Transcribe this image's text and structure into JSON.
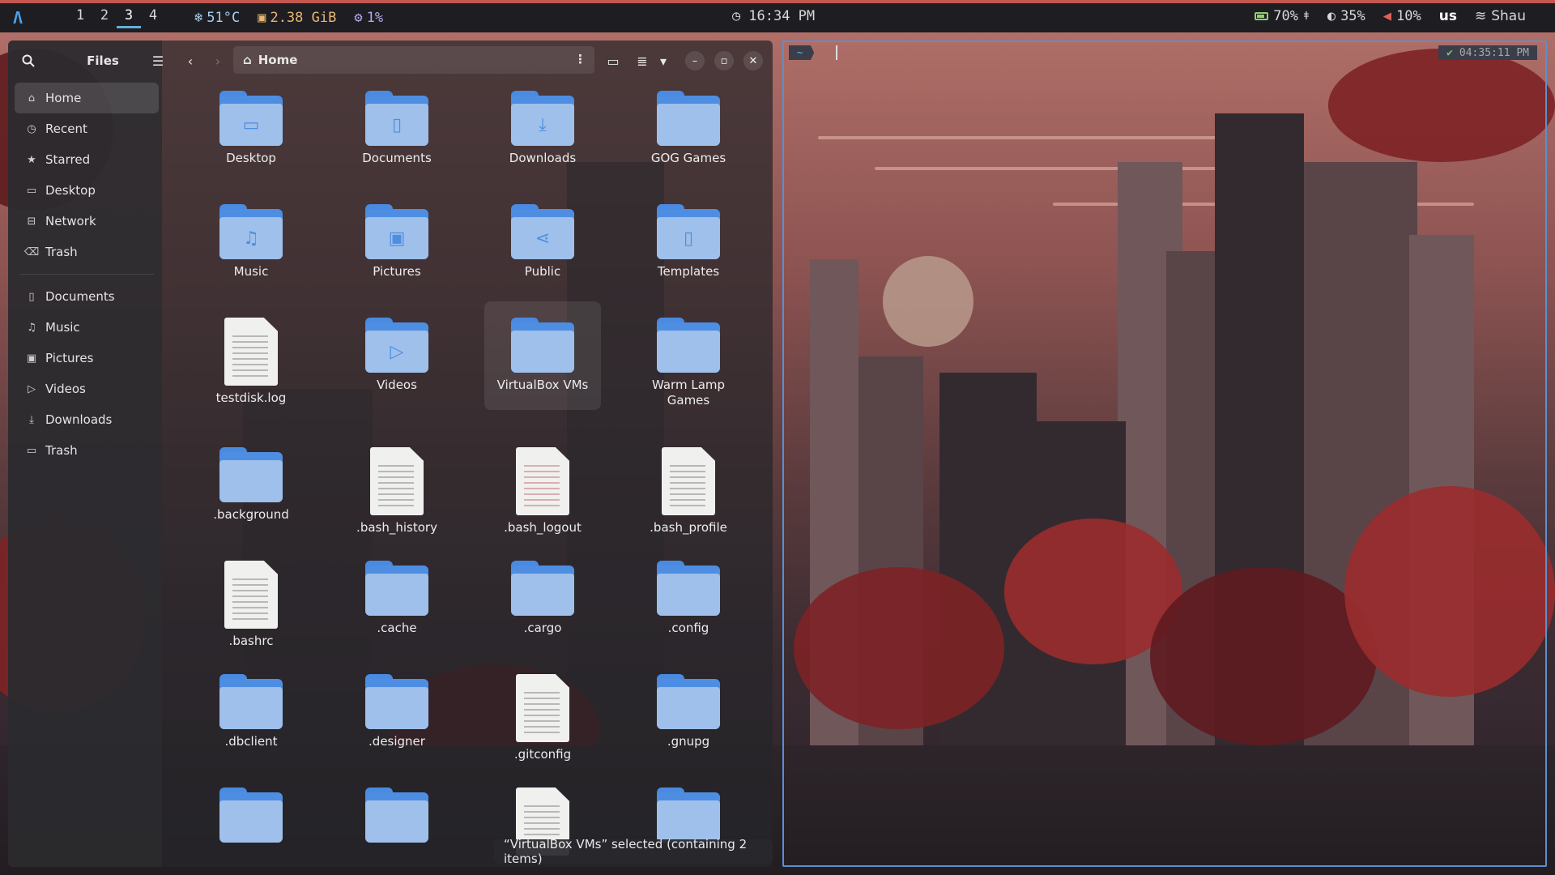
{
  "topbar": {
    "workspaces": [
      "1",
      "2",
      "3",
      "4"
    ],
    "active_workspace": "3",
    "temperature": "51°C",
    "memory": "2.38 GiB",
    "cpu": "1%",
    "clock": "16:34 PM",
    "battery": "70%",
    "brightness": "35%",
    "volume": "10%",
    "keyboard_layout": "us",
    "user": "Shau"
  },
  "files": {
    "title": "Files",
    "path": "Home",
    "sidebar": {
      "places": [
        {
          "label": "Home",
          "icon": "home-icon",
          "active": true
        },
        {
          "label": "Recent",
          "icon": "clock-icon"
        },
        {
          "label": "Starred",
          "icon": "star-icon"
        },
        {
          "label": "Desktop",
          "icon": "folder-icon"
        },
        {
          "label": "Network",
          "icon": "network-icon"
        },
        {
          "label": "Trash",
          "icon": "trash-icon"
        }
      ],
      "bookmarks": [
        {
          "label": "Documents",
          "icon": "document-icon"
        },
        {
          "label": "Music",
          "icon": "music-icon"
        },
        {
          "label": "Pictures",
          "icon": "image-icon"
        },
        {
          "label": "Videos",
          "icon": "video-icon"
        },
        {
          "label": "Downloads",
          "icon": "download-icon"
        },
        {
          "label": "Trash",
          "icon": "trash-icon"
        }
      ]
    },
    "items": [
      {
        "name": "Desktop",
        "kind": "folder",
        "emblem": "folder-icon"
      },
      {
        "name": "Documents",
        "kind": "folder",
        "emblem": "document-icon"
      },
      {
        "name": "Downloads",
        "kind": "folder",
        "emblem": "download-icon"
      },
      {
        "name": "GOG Games",
        "kind": "folder",
        "emblem": ""
      },
      {
        "name": "Music",
        "kind": "folder",
        "emblem": "music-icon"
      },
      {
        "name": "Pictures",
        "kind": "folder",
        "emblem": "image-icon"
      },
      {
        "name": "Public",
        "kind": "folder",
        "emblem": "share-icon"
      },
      {
        "name": "Templates",
        "kind": "folder",
        "emblem": "document-icon"
      },
      {
        "name": "testdisk.log",
        "kind": "file"
      },
      {
        "name": "Videos",
        "kind": "folder",
        "emblem": "video-icon"
      },
      {
        "name": "VirtualBox VMs",
        "kind": "folder",
        "emblem": "",
        "selected": true
      },
      {
        "name": "Warm Lamp Games",
        "kind": "folder",
        "emblem": ""
      },
      {
        "name": ".background",
        "kind": "folder",
        "emblem": ""
      },
      {
        "name": ".bash_history",
        "kind": "file"
      },
      {
        "name": ".bash_logout",
        "kind": "file",
        "warm": true
      },
      {
        "name": ".bash_profile",
        "kind": "file"
      },
      {
        "name": ".bashrc",
        "kind": "file"
      },
      {
        "name": ".cache",
        "kind": "folder",
        "emblem": ""
      },
      {
        "name": ".cargo",
        "kind": "folder",
        "emblem": ""
      },
      {
        "name": ".config",
        "kind": "folder",
        "emblem": ""
      },
      {
        "name": ".dbclient",
        "kind": "folder",
        "emblem": ""
      },
      {
        "name": ".designer",
        "kind": "folder",
        "emblem": ""
      },
      {
        "name": ".gitconfig",
        "kind": "file"
      },
      {
        "name": ".gnupg",
        "kind": "folder",
        "emblem": ""
      },
      {
        "name": "",
        "kind": "folder",
        "emblem": ""
      },
      {
        "name": "",
        "kind": "folder",
        "emblem": ""
      },
      {
        "name": "",
        "kind": "file"
      },
      {
        "name": "",
        "kind": "folder",
        "emblem": ""
      }
    ],
    "status_toast": "“VirtualBox VMs” selected  (containing 2 items)"
  },
  "terminal": {
    "prompt_dir": "~",
    "time": "04:35:11 PM",
    "status_glyph": "✔"
  },
  "colors": {
    "accent_blue": "#4e8ee2",
    "topbar_border": "#c4574f",
    "terminal_border": "#5a8fd0"
  }
}
